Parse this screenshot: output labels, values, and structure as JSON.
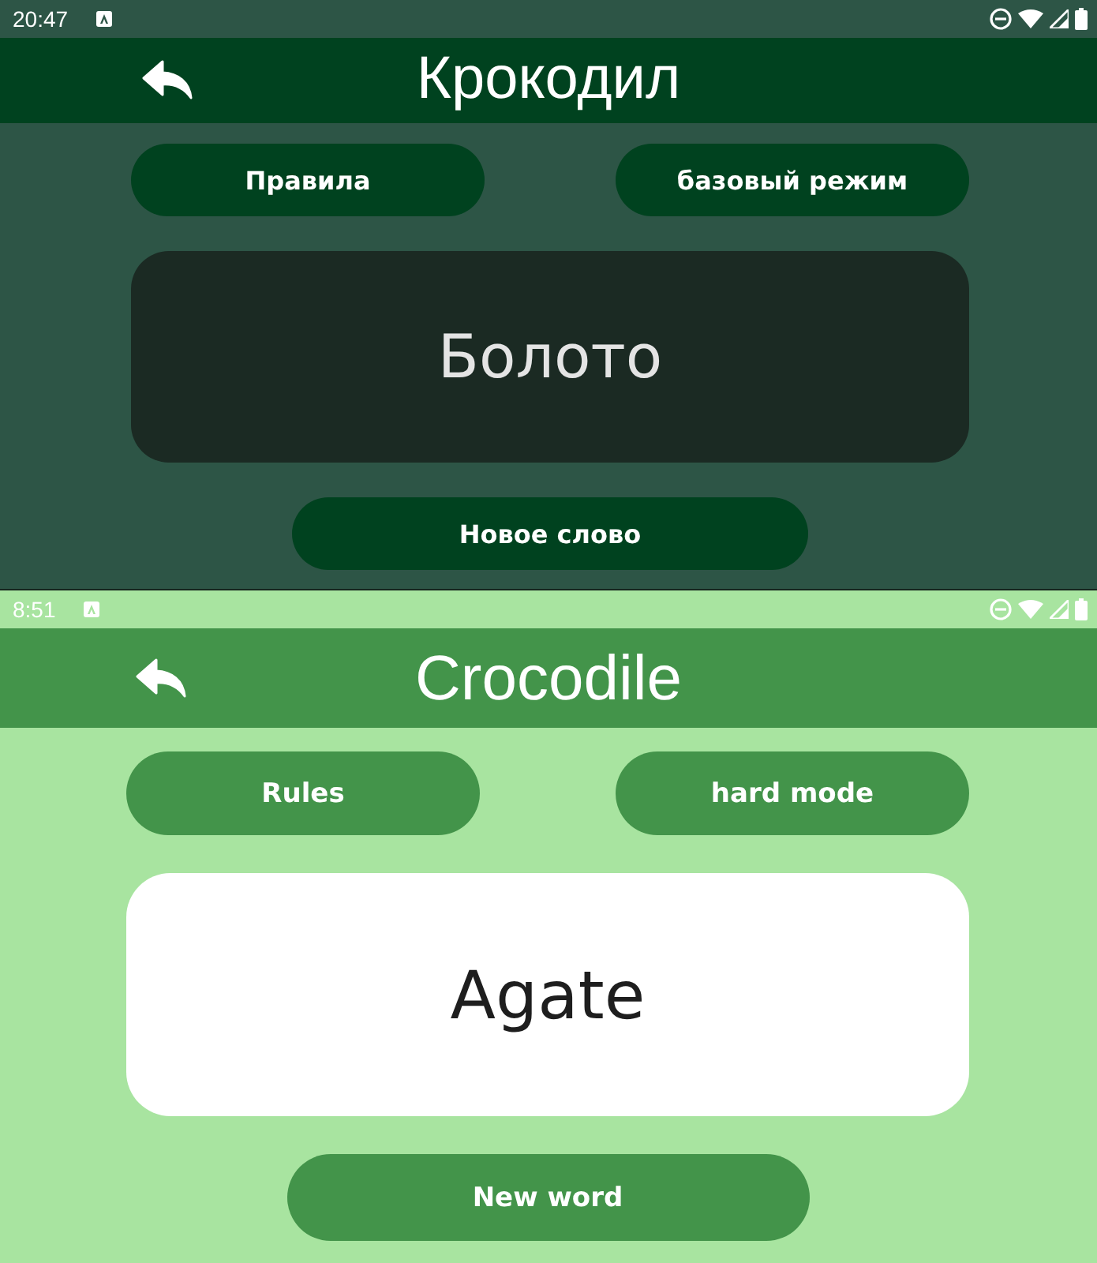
{
  "screens": [
    {
      "kind": "dark",
      "status_bar": {
        "time": "20:47"
      },
      "app_bar": {
        "title": "Крокодил"
      },
      "buttons": [
        {
          "label": "Правила"
        },
        {
          "label": "базовый режим"
        }
      ],
      "word_card": {
        "word": "Болото"
      },
      "new_word_button": {
        "label": "Новое слово"
      }
    },
    {
      "kind": "light",
      "status_bar": {
        "time": "8:51"
      },
      "app_bar": {
        "title": "Crocodile"
      },
      "buttons": [
        {
          "label": "Rules"
        },
        {
          "label": "hard mode"
        }
      ],
      "word_card": {
        "word": "Agate"
      },
      "new_word_button": {
        "label": "New word"
      }
    }
  ]
}
